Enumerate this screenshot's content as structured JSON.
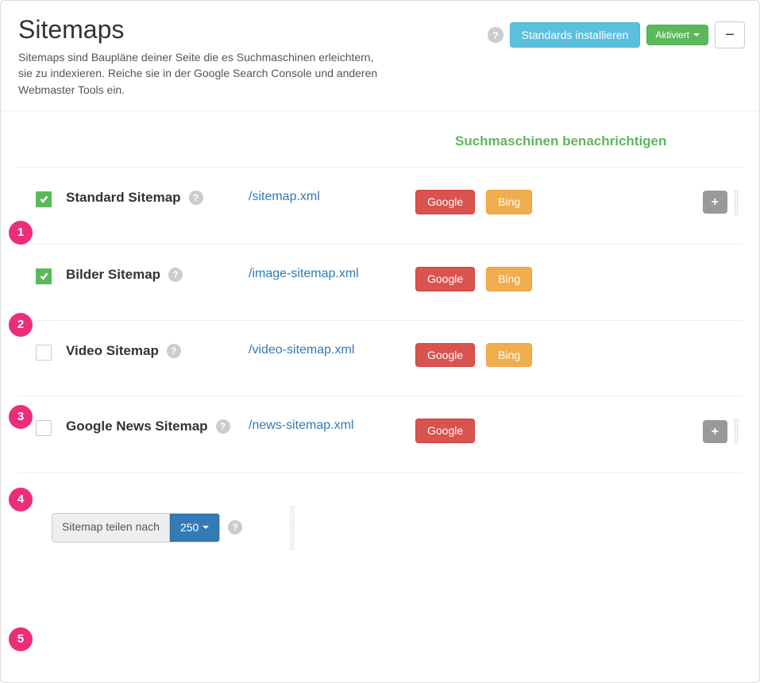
{
  "header": {
    "title": "Sitemaps",
    "description": "Sitemaps sind Baupläne deiner Seite die es Suchmaschinen erleichtern, sie zu indexieren. Reiche sie in der Google Search Console und anderen Webmaster Tools ein.",
    "install_label": "Standards installieren",
    "status_label": "Aktiviert",
    "collapse_glyph": "−"
  },
  "notify_header": "Suchmaschinen benachrichtigen",
  "rows": [
    {
      "checked": true,
      "title": "Standard Sitemap",
      "url": "/sitemap.xml",
      "google": "Google",
      "bing": "Bing",
      "has_bing": true,
      "has_plus": true,
      "plus_glyph": "+"
    },
    {
      "checked": true,
      "title": "Bilder Sitemap",
      "url": "/image-sitemap.xml",
      "google": "Google",
      "bing": "Bing",
      "has_bing": true,
      "has_plus": false
    },
    {
      "checked": false,
      "title": "Video Sitemap",
      "url": "/video-sitemap.xml",
      "google": "Google",
      "bing": "Bing",
      "has_bing": true,
      "has_plus": false
    },
    {
      "checked": false,
      "title": "Google News Sitemap",
      "url": "/news-sitemap.xml",
      "google": "Google",
      "has_bing": false,
      "has_plus": true,
      "plus_glyph": "+"
    }
  ],
  "footer": {
    "split_label": "Sitemap teilen nach",
    "split_value": "250"
  },
  "annotations": [
    "1",
    "2",
    "3",
    "4",
    "5"
  ]
}
